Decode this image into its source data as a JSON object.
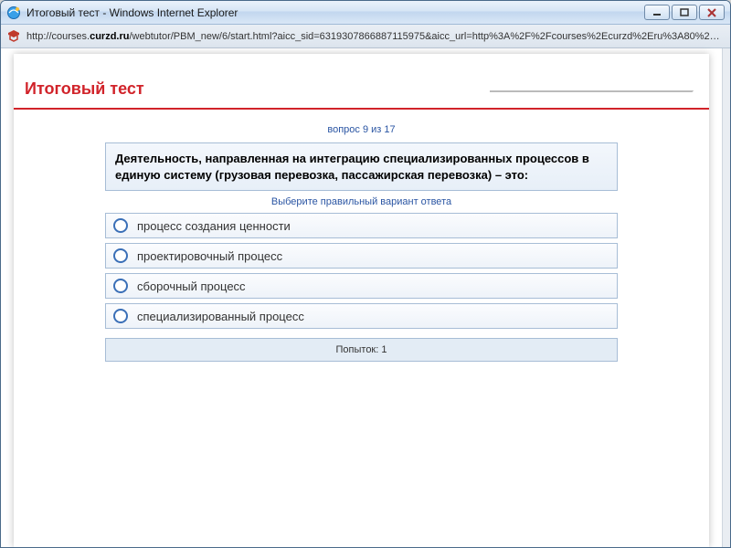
{
  "window": {
    "title": "Итоговый тест - Windows Internet Explorer"
  },
  "address": {
    "prefix": "http://courses.",
    "domain": "curzd.ru",
    "path": "/webtutor/PBM_new/6/start.html?aicc_sid=6319307866887115975&aicc_url=http%3A%2F%2Fcourses%2Ecurzd%2Eru%3A80%2Fhandler%2Ehtml"
  },
  "page": {
    "title": "Итоговый тест"
  },
  "quiz": {
    "counter": "вопрос 9 из 17",
    "question": "Деятельность, направленная на интеграцию специализированных процессов в единую систему (грузовая перевозка, пассажирская перевозка) – это:",
    "hint": "Выберите правильный вариант ответа",
    "options": [
      "процесс создания ценности",
      "проектировочный процесс",
      "сборочный процесс",
      "специализированный процесс"
    ],
    "attempts_label": "Попыток: 1"
  }
}
